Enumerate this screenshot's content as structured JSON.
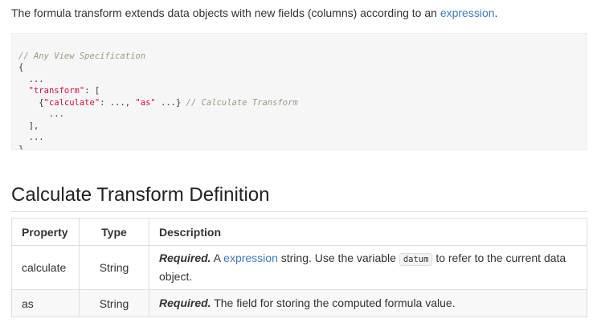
{
  "intro": {
    "text_before": "The formula transform extends data objects with new fields (columns) according to an ",
    "link_text": "expression",
    "text_after": "."
  },
  "code": {
    "line1_comment": "// Any View Specification",
    "line2": "{",
    "line3": "  ...",
    "line4_key": "\"transform\"",
    "line4_rest": ": [",
    "line5_open": "    {",
    "line5_key1": "\"calculate\"",
    "line5_mid": ": ..., ",
    "line5_key2": "\"as\"",
    "line5_end": " ...} ",
    "line5_comment": "// Calculate Transform",
    "line6": "      ...",
    "line7": "  ],",
    "line8": "  ...",
    "line9": "}"
  },
  "section": {
    "title": "Calculate Transform Definition"
  },
  "table": {
    "headers": [
      "Property",
      "Type",
      "Description"
    ],
    "rows": [
      {
        "property": "calculate",
        "type": "String",
        "required_label": "Required.",
        "desc_before": " A ",
        "desc_link": "expression",
        "desc_mid": " string. Use the variable ",
        "desc_code": "datum",
        "desc_after": " to refer to the current data object."
      },
      {
        "property": "as",
        "type": "String",
        "required_label": "Required.",
        "desc_text": " The field for storing the computed formula value."
      }
    ]
  },
  "colors": {
    "link": "#3f7bbf",
    "code_string": "#d01040",
    "code_comment": "#999988",
    "code_background": "#f6f6f6"
  }
}
